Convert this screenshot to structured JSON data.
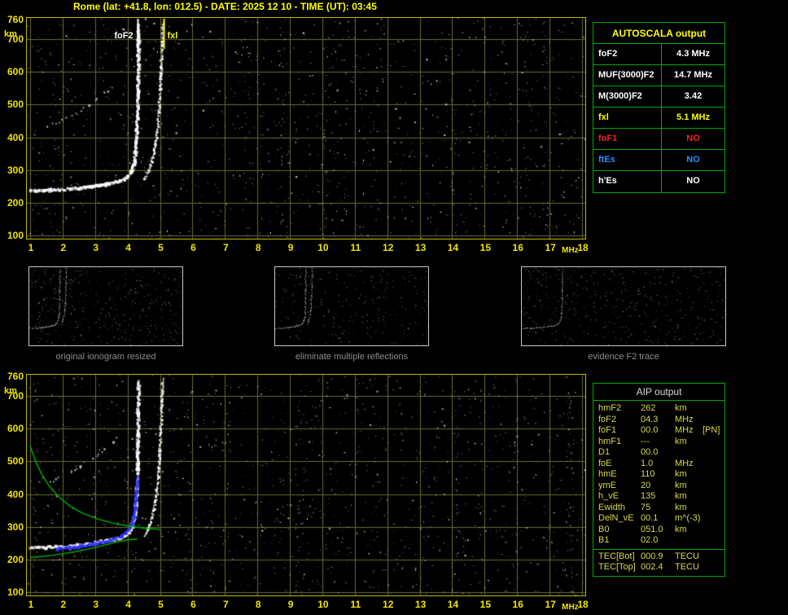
{
  "title": "Rome (lat: +41.8, lon: 012.5) - DATE: 2025 12 10 - TIME (UT): 03:45",
  "colors": {
    "accent_yellow": "#ffff00",
    "grid_olive": "#6a6a30",
    "table_green": "#00a800",
    "status_no_red": "#ff2020",
    "status_no_blue": "#2a8cff",
    "trace_white": "#ffffff",
    "restored_trace_blue": "#3030ff",
    "profile_green": "#00b400",
    "caption_gray": "#8c8c8c"
  },
  "autoscala_table": {
    "title": "AUTOSCALA output",
    "rows": [
      {
        "label": "foF2",
        "value": "4.3 MHz",
        "color": "#ffffff"
      },
      {
        "label": "MUF(3000)F2",
        "value": "14.7 MHz",
        "color": "#ffffff"
      },
      {
        "label": "M(3000)F2",
        "value": "3.42",
        "color": "#ffffff"
      },
      {
        "label": "fxl",
        "value": "5.1 MHz",
        "color": "#ffff00"
      },
      {
        "label": "foF1",
        "value": "NO",
        "color": "#ff2020"
      },
      {
        "label": "ftEs",
        "value": "NO",
        "color": "#2a8cff"
      },
      {
        "label": "h'Es",
        "value": "NO",
        "color": "#ffffff"
      }
    ]
  },
  "aip_table": {
    "title": "AIP output",
    "rows": [
      {
        "label": "hmF2",
        "value": "262",
        "unit": "km",
        "extra": ""
      },
      {
        "label": "foF2",
        "value": "04.3",
        "unit": "MHz",
        "extra": ""
      },
      {
        "label": "foF1",
        "value": "00.0",
        "unit": "MHz",
        "extra": "[PN]"
      },
      {
        "label": "hmF1",
        "value": "---",
        "unit": "km",
        "extra": ""
      },
      {
        "label": "D1",
        "value": "00.0",
        "unit": "",
        "extra": ""
      },
      {
        "label": "foE",
        "value": "1.0",
        "unit": "MHz",
        "extra": ""
      },
      {
        "label": "hmE",
        "value": "110",
        "unit": "km",
        "extra": ""
      },
      {
        "label": "ymE",
        "value": "20",
        "unit": "km",
        "extra": ""
      },
      {
        "label": "h_vE",
        "value": "135",
        "unit": "km",
        "extra": ""
      },
      {
        "label": "Ewidth",
        "value": "75",
        "unit": "km",
        "extra": ""
      },
      {
        "label": "DelN_vE",
        "value": "00.1",
        "unit": "m^(-3)",
        "extra": ""
      },
      {
        "label": "B0",
        "value": "051.0",
        "unit": "km",
        "extra": ""
      },
      {
        "label": "B1",
        "value": "02.0",
        "unit": "",
        "extra": ""
      },
      {
        "label": "TEC[Bot]",
        "value": "000.9",
        "unit": "TECU",
        "extra": "",
        "separator_above": true
      },
      {
        "label": "TEC[Top]",
        "value": "002.4",
        "unit": "TECU",
        "extra": ""
      }
    ]
  },
  "thumbnails": [
    {
      "caption": "original ionogram resized",
      "series": [
        "F2 ordinary trace",
        "F2 extraordinary trace",
        "second reflection"
      ]
    },
    {
      "caption": "eliminate multiple reflections",
      "series": [
        "F2 ordinary trace",
        "F2 extraordinary trace"
      ]
    },
    {
      "caption": "evidence F2 trace",
      "series": [
        "F2 ordinary trace"
      ]
    }
  ],
  "chart_data": [
    {
      "id": "ionogram-main",
      "type": "scatter",
      "xlabel": "MHz",
      "ylabel": "km",
      "xlim": [
        0.9,
        18.1
      ],
      "ylim": [
        90,
        765
      ],
      "x_ticks": [
        1,
        2,
        3,
        4,
        5,
        6,
        7,
        8,
        9,
        10,
        11,
        12,
        13,
        14,
        15,
        16,
        17,
        18
      ],
      "y_ticks": [
        760,
        700,
        600,
        500,
        400,
        300,
        200,
        100
      ],
      "grid": true,
      "markers": [
        {
          "name": "foF2",
          "label": "foF2",
          "x": 4.3,
          "color": "#ffffff",
          "side": "left"
        },
        {
          "name": "fxl",
          "label": "fxl",
          "x": 5.1,
          "color": "#ffff00",
          "side": "right"
        }
      ],
      "series": [
        {
          "name": "F2 ordinary trace",
          "style": "dots",
          "color": "#ffffff",
          "size": 3,
          "points": [
            [
              1.0,
              236
            ],
            [
              1.3,
              236
            ],
            [
              1.6,
              237
            ],
            [
              1.9,
              239
            ],
            [
              2.2,
              241
            ],
            [
              2.5,
              244
            ],
            [
              2.8,
              248
            ],
            [
              3.1,
              252
            ],
            [
              3.4,
              257
            ],
            [
              3.7,
              263
            ],
            [
              3.9,
              271
            ],
            [
              4.05,
              283
            ],
            [
              4.15,
              300
            ],
            [
              4.22,
              327
            ],
            [
              4.27,
              368
            ],
            [
              4.3,
              425
            ],
            [
              4.32,
              490
            ],
            [
              4.33,
              560
            ],
            [
              4.34,
              635
            ],
            [
              4.35,
              745
            ]
          ]
        },
        {
          "name": "F2 extraordinary trace",
          "style": "dots",
          "color": "#ffffff",
          "size": 2,
          "points": [
            [
              4.52,
              272
            ],
            [
              4.62,
              290
            ],
            [
              4.72,
              315
            ],
            [
              4.81,
              348
            ],
            [
              4.89,
              393
            ],
            [
              4.95,
              450
            ],
            [
              5.0,
              520
            ],
            [
              5.04,
              600
            ],
            [
              5.07,
              680
            ],
            [
              5.09,
              750
            ]
          ]
        },
        {
          "name": "second reflection",
          "style": "dots-sparse",
          "color": "#c8c8c8",
          "size": 2,
          "points": [
            [
              1.55,
              432
            ],
            [
              1.8,
              444
            ],
            [
              2.05,
              456
            ],
            [
              2.3,
              469
            ],
            [
              2.55,
              483
            ],
            [
              2.8,
              498
            ],
            [
              3.05,
              515
            ],
            [
              3.3,
              534
            ],
            [
              3.55,
              556
            ],
            [
              3.75,
              582
            ]
          ]
        }
      ]
    },
    {
      "id": "ionogram-aip",
      "type": "scatter",
      "xlabel": "MHz",
      "ylabel": "km",
      "xlim": [
        0.9,
        18.1
      ],
      "ylim": [
        90,
        765
      ],
      "x_ticks": [
        1,
        2,
        3,
        4,
        5,
        6,
        7,
        8,
        9,
        10,
        11,
        12,
        13,
        14,
        15,
        16,
        17,
        18
      ],
      "y_ticks": [
        760,
        700,
        600,
        500,
        400,
        300,
        200,
        100
      ],
      "grid": true,
      "inherit_series_from": 0,
      "series": [
        {
          "name": "restored F2 trace",
          "style": "dots",
          "color": "#3030ff",
          "size": 3,
          "points": [
            [
              1.85,
              232
            ],
            [
              2.1,
              234
            ],
            [
              2.35,
              237
            ],
            [
              2.6,
              240
            ],
            [
              2.85,
              244
            ],
            [
              3.1,
              249
            ],
            [
              3.35,
              255
            ],
            [
              3.6,
              262
            ],
            [
              3.8,
              270
            ],
            [
              3.95,
              280
            ],
            [
              4.08,
              295
            ],
            [
              4.18,
              318
            ],
            [
              4.25,
              352
            ],
            [
              4.29,
              400
            ],
            [
              4.31,
              450
            ]
          ]
        },
        {
          "name": "MUF transmission curve",
          "style": "line",
          "color": "#00b400",
          "width": 1.4,
          "points": [
            [
              1.0,
              548
            ],
            [
              1.15,
              505
            ],
            [
              1.35,
              462
            ],
            [
              1.6,
              423
            ],
            [
              1.9,
              390
            ],
            [
              2.25,
              362
            ],
            [
              2.65,
              340
            ],
            [
              3.1,
              323
            ],
            [
              3.6,
              310
            ],
            [
              4.1,
              301
            ],
            [
              4.6,
              295
            ],
            [
              5.0,
              292
            ]
          ]
        },
        {
          "name": "electron density profile",
          "style": "line",
          "color": "#00b400",
          "width": 1.4,
          "points": [
            [
              1.0,
              206
            ],
            [
              1.35,
              209
            ],
            [
              1.7,
              213
            ],
            [
              2.05,
              218
            ],
            [
              2.4,
              224
            ],
            [
              2.75,
              231
            ],
            [
              3.1,
              239
            ],
            [
              3.45,
              248
            ],
            [
              3.75,
              255
            ],
            [
              4.0,
              260
            ],
            [
              4.2,
              262
            ],
            [
              4.3,
              262
            ]
          ]
        }
      ]
    }
  ]
}
